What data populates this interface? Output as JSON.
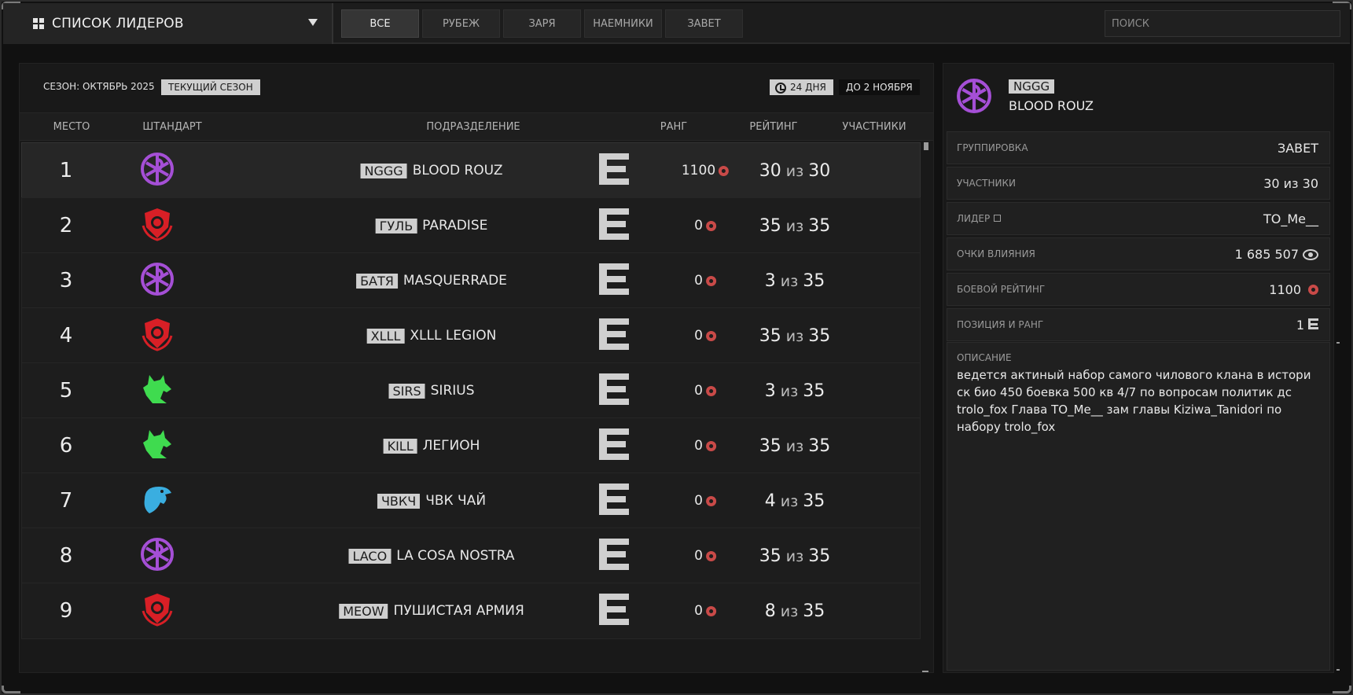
{
  "header": {
    "title": "СПИСОК ЛИДЕРОВ",
    "tabs": [
      {
        "label": "ВСЕ",
        "active": true
      },
      {
        "label": "РУБЕЖ",
        "active": false
      },
      {
        "label": "ЗАРЯ",
        "active": false
      },
      {
        "label": "НАЕМНИКИ",
        "active": false
      },
      {
        "label": "ЗАВЕТ",
        "active": false
      }
    ],
    "search_placeholder": "ПОИСК"
  },
  "season": {
    "label": "СЕЗОН: ОКТЯБРЬ 2025",
    "badge": "ТЕКУЩИЙ СЕЗОН",
    "timer": "24 ДНЯ",
    "until": "ДО 2 НОЯБРЯ"
  },
  "columns": {
    "place": "МЕСТО",
    "standard": "ШТАНДАРТ",
    "unit": "ПОДРАЗДЕЛЕНИЕ",
    "rank": "РАНГ",
    "rating": "РЕЙТИНГ",
    "members": "УЧАСТНИКИ"
  },
  "emblem_colors": {
    "violet": "#a54fd6",
    "red": "#d81f26",
    "green": "#3fdb4f",
    "blue": "#3aaee0"
  },
  "rows": [
    {
      "place": "1",
      "emblem": "violet-chi-rho-emblem",
      "color": "violet",
      "tag": "NGGG",
      "name": "BLOOD ROUZ",
      "rating": "1100",
      "members_now": "30",
      "of": "из",
      "members_max": "30"
    },
    {
      "place": "2",
      "emblem": "red-shield-emblem",
      "color": "red",
      "tag": "ГУЛЬ",
      "name": "PARADISE",
      "rating": "0",
      "members_now": "35",
      "of": "из",
      "members_max": "35"
    },
    {
      "place": "3",
      "emblem": "violet-chi-rho-emblem",
      "color": "violet",
      "tag": "БАТЯ",
      "name": "MASQUERRADE",
      "rating": "0",
      "members_now": "3",
      "of": "из",
      "members_max": "35"
    },
    {
      "place": "4",
      "emblem": "red-shield-emblem",
      "color": "red",
      "tag": "XLLL",
      "name": "XLLL LEGION",
      "rating": "0",
      "members_now": "35",
      "of": "из",
      "members_max": "35"
    },
    {
      "place": "5",
      "emblem": "green-wolf-emblem",
      "color": "green",
      "tag": "SIRS",
      "name": "SIRIUS",
      "rating": "0",
      "members_now": "3",
      "of": "из",
      "members_max": "35"
    },
    {
      "place": "6",
      "emblem": "green-wolf-emblem",
      "color": "green",
      "tag": "KILL",
      "name": "ЛЕГИОН",
      "rating": "0",
      "members_now": "35",
      "of": "из",
      "members_max": "35"
    },
    {
      "place": "7",
      "emblem": "blue-eagle-emblem",
      "color": "blue",
      "tag": "ЧВКЧ",
      "name": "ЧВК ЧАЙ",
      "rating": "0",
      "members_now": "4",
      "of": "из",
      "members_max": "35"
    },
    {
      "place": "8",
      "emblem": "violet-chi-rho-emblem",
      "color": "violet",
      "tag": "LACO",
      "name": "LA COSA NOSTRA",
      "rating": "0",
      "members_now": "35",
      "of": "из",
      "members_max": "35"
    },
    {
      "place": "9",
      "emblem": "red-shield-emblem",
      "color": "red",
      "tag": "MEOW",
      "name": "ПУШИСТАЯ АРМИЯ",
      "rating": "0",
      "members_now": "8",
      "of": "из",
      "members_max": "35"
    }
  ],
  "details": {
    "tag": "NGGG",
    "name": "BLOOD ROUZ",
    "faction_key": "ГРУППИРОВКА",
    "faction_val": "ЗАВЕТ",
    "members_key": "УЧАСТНИКИ",
    "members_val": "30 из 30",
    "leader_key": "ЛИДЕР",
    "leader_val": "TO_Me__",
    "influence_key": "ОЧКИ ВЛИЯНИЯ",
    "influence_val": "1 685 507",
    "combat_key": "БОЕВОЙ РЕЙТИНГ",
    "combat_val": "1100",
    "position_key": "ПОЗИЦИЯ И РАНГ",
    "position_val": "1",
    "desc_key": "ОПИСАНИЕ",
    "desc_text": "ведется актиный набор самого чилового клана в истори ск био 450 боевка 500 кв 4/7 по вопросам политик дс trolo_fox Глава TO_Me__ зам главы Kiziwa_Tanidori по набору trolo_fox"
  }
}
